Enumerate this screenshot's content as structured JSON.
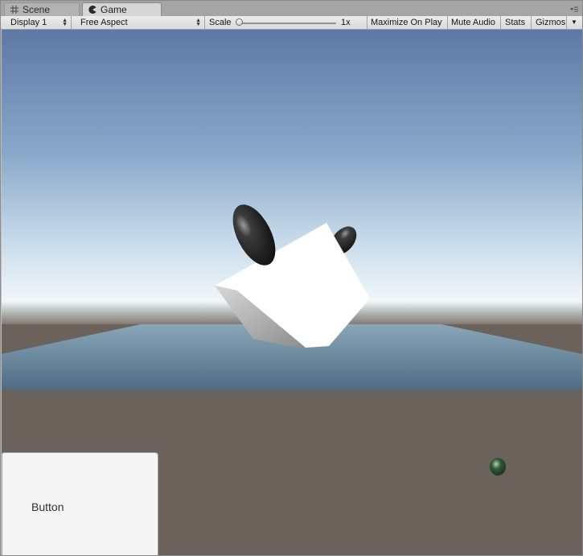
{
  "tabs": [
    {
      "label": "Scene",
      "icon": "grid-icon",
      "active": false
    },
    {
      "label": "Game",
      "icon": "pacman-icon",
      "active": true
    }
  ],
  "toolbar": {
    "display": "Display 1",
    "aspect": "Free Aspect",
    "scale_label": "Scale",
    "scale_value": "1x",
    "maximize": "Maximize On Play",
    "mute": "Mute Audio",
    "stats": "Stats",
    "gizmos": "Gizmos"
  },
  "game_ui": {
    "button_label": "Button"
  },
  "colors": {
    "sky_top": "#5f7aa6",
    "sky_horizon": "#eef6fb",
    "ground": "#6c625c",
    "plane": "#6b8aa0",
    "cube": "#ffffff"
  }
}
